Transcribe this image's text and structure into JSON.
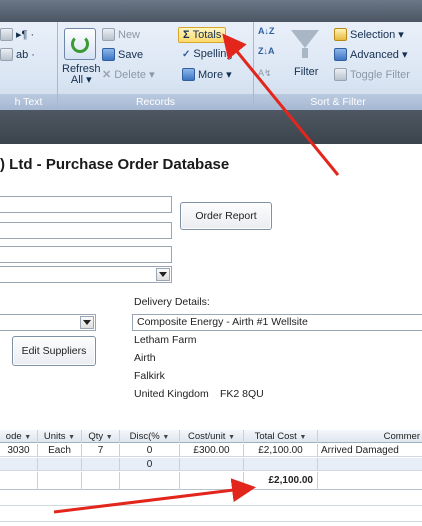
{
  "ribbon": {
    "groups": {
      "rich_text_label": "h Text",
      "records_label": "Records",
      "sort_filter_label": "Sort & Filter"
    },
    "rich_text": {
      "btn1": "▸¶ ·",
      "btn2": "ab ·"
    },
    "refresh": {
      "label_line1": "Refresh",
      "label_line2": "All ▾"
    },
    "records": {
      "new": "New",
      "save": "Save",
      "delete": "Delete ▾",
      "totals": "Totals",
      "spelling": "Spelling",
      "more": "More ▾"
    },
    "sort": {
      "asc": "A↓Z",
      "desc": "Z↓A",
      "clear": "A↯"
    },
    "filter": {
      "filter": "Filter",
      "selection": "Selection ▾",
      "advanced": "Advanced ▾",
      "toggle": "Toggle Filter"
    }
  },
  "form": {
    "title": ") Ltd - Purchase Order Database",
    "order_report_button": "Order Report",
    "edit_suppliers_button": "Edit Suppliers",
    "delivery": {
      "heading": "Delivery Details:",
      "selected": "Composite Energy - Airth #1 Wellsite",
      "line1": "Letham Farm",
      "line2": "Airth",
      "line3": "Falkirk",
      "country": "United Kingdom",
      "postcode": "FK2 8QU"
    }
  },
  "datasheet": {
    "columns": [
      "ode",
      "Units",
      "Qty",
      "Disc(%",
      "Cost/unit",
      "Total Cost",
      "Commer"
    ],
    "rows": [
      [
        "3030",
        "Each",
        "7",
        "0",
        "£300.00",
        "£2,100.00",
        "Arrived Damaged"
      ],
      [
        "",
        "",
        "",
        "0",
        "",
        "",
        ""
      ]
    ],
    "total": "£2,100.00"
  },
  "colors": {
    "arrow": "#e3261c",
    "ribbon_label": "#a6b8d2",
    "dark_band": "#3b434c"
  }
}
